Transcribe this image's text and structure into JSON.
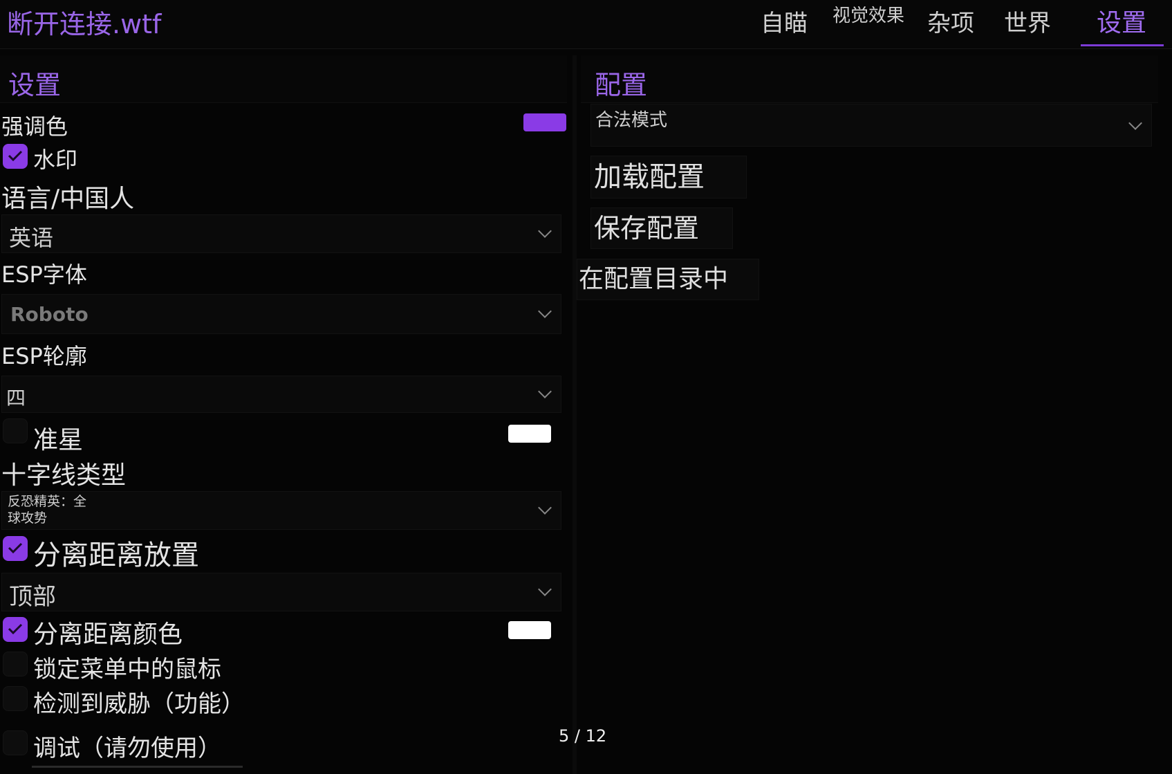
{
  "app": {
    "title": "断开连接.wtf"
  },
  "tabs": [
    {
      "label": "自瞄"
    },
    {
      "label": "视觉效果"
    },
    {
      "label": "杂项"
    },
    {
      "label": "世界"
    },
    {
      "label": "设置",
      "active": true
    }
  ],
  "settings": {
    "title": "设置",
    "accent_color": {
      "label": "强调色",
      "value": "#8a3be6"
    },
    "watermark": {
      "label": "水印",
      "checked": true
    },
    "language": {
      "label": "语言/中国人",
      "value": "英语"
    },
    "esp_font": {
      "label": "ESP字体",
      "value": "Roboto"
    },
    "esp_outline": {
      "label": "ESP轮廓",
      "value": "四"
    },
    "crosshair": {
      "label": "准星",
      "checked": false,
      "color": "#ffffff"
    },
    "crosshair_type": {
      "label": "十字线类型",
      "value": "反恐精英：全球攻势"
    },
    "distance_placement": {
      "label": "分离距离放置",
      "checked": true,
      "value": "顶部"
    },
    "distance_color": {
      "label": "分离距离颜色",
      "checked": true,
      "color": "#ffffff"
    },
    "lock_mouse": {
      "label": "锁定菜单中的鼠标",
      "checked": false
    },
    "threat_detect": {
      "label": "检测到威胁（功能）",
      "checked": false
    },
    "debug": {
      "label": "调试（请勿使用）",
      "checked": false
    }
  },
  "config": {
    "title": "配置",
    "selected": "合法模式",
    "load_label": "加载配置",
    "save_label": "保存配置",
    "open_dir_label": "在配置目录中"
  },
  "pagination": {
    "text": "5 / 12"
  },
  "colors": {
    "accent": "#8a3be6",
    "background": "#050505"
  }
}
